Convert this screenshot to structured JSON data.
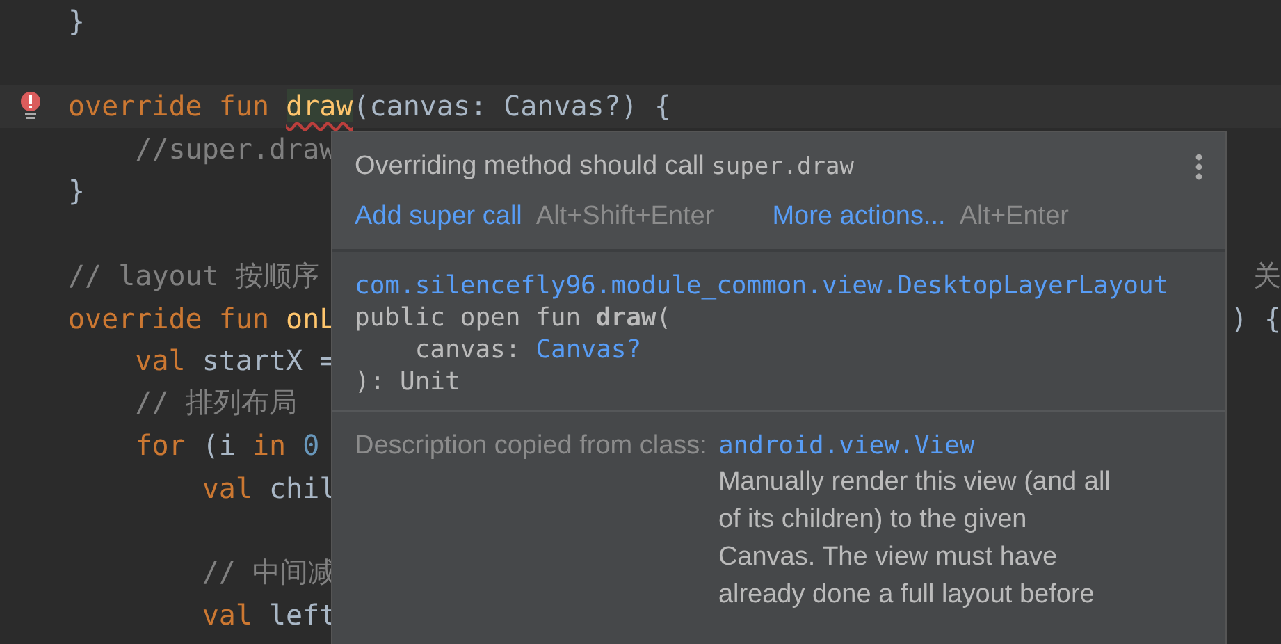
{
  "editor": {
    "lines": [
      {
        "kind": "code",
        "tokens": [
          {
            "kind": "plain",
            "text": "}"
          }
        ]
      },
      {
        "kind": "blank"
      },
      {
        "kind": "error_line",
        "tokens": [
          {
            "kind": "keyword",
            "text": "override "
          },
          {
            "kind": "keyword",
            "text": "fun "
          },
          {
            "kind": "error_fn",
            "text": "draw"
          },
          {
            "kind": "plain",
            "text": "(canvas: Canvas?) {"
          }
        ]
      },
      {
        "kind": "code",
        "tokens": [
          {
            "kind": "comment",
            "text": "    //super.draw"
          }
        ]
      },
      {
        "kind": "code",
        "tokens": [
          {
            "kind": "plain",
            "text": "}"
          }
        ]
      },
      {
        "kind": "blank"
      },
      {
        "kind": "code",
        "tokens": [
          {
            "kind": "comment",
            "text": "// layout 按顺序"
          }
        ],
        "tail": [
          {
            "kind": "comment",
            "text": "关"
          }
        ]
      },
      {
        "kind": "code",
        "tokens": [
          {
            "kind": "keyword",
            "text": "override "
          },
          {
            "kind": "keyword",
            "text": "fun "
          },
          {
            "kind": "fn",
            "text": "onL"
          }
        ],
        "tail": [
          {
            "kind": "plain",
            "text": ") {"
          }
        ]
      },
      {
        "kind": "code",
        "tokens": [
          {
            "kind": "keyword",
            "text": "    val "
          },
          {
            "kind": "plain",
            "text": "startX ="
          }
        ]
      },
      {
        "kind": "code",
        "tokens": [
          {
            "kind": "comment",
            "text": "    // 排列布局"
          }
        ]
      },
      {
        "kind": "code",
        "tokens": [
          {
            "kind": "keyword",
            "text": "    for "
          },
          {
            "kind": "plain",
            "text": "(i "
          },
          {
            "kind": "keyword",
            "text": "in "
          },
          {
            "kind": "number",
            "text": "0"
          }
        ]
      },
      {
        "kind": "code",
        "tokens": [
          {
            "kind": "keyword",
            "text": "        val "
          },
          {
            "kind": "plain",
            "text": "chil"
          }
        ]
      },
      {
        "kind": "blank"
      },
      {
        "kind": "code",
        "tokens": [
          {
            "kind": "comment",
            "text": "        // 中间减"
          }
        ]
      },
      {
        "kind": "code",
        "tokens": [
          {
            "kind": "keyword",
            "text": "        val "
          },
          {
            "kind": "plain",
            "text": "left"
          }
        ]
      }
    ]
  },
  "popup": {
    "message": "Overriding method should call",
    "message_code": "super.draw",
    "actions": [
      {
        "label": "Add super call",
        "shortcut": "Alt+Shift+Enter"
      },
      {
        "label": "More actions...",
        "shortcut": "Alt+Enter"
      }
    ],
    "declaration": {
      "container": "com.silencefly96.module_common.view.DesktopLayerLayout",
      "signature": [
        {
          "text": "public open fun **draw**("
        },
        {
          "text": "    canvas:",
          "type_name": "Canvas?"
        },
        {
          "text": "): Unit"
        }
      ]
    },
    "description": {
      "label": "Description copied from class:",
      "class_link": "android.view.View",
      "text": "Manually render this view (and all of its children) to the given Canvas. The view must have already done a full layout before"
    }
  }
}
